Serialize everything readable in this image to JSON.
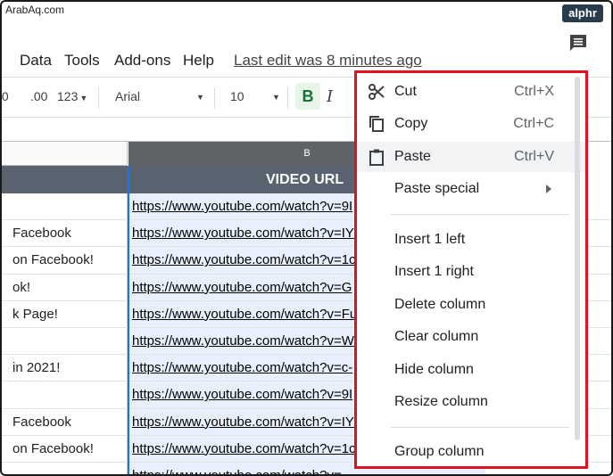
{
  "watermark": "ArabAq.com",
  "brand": "alphr",
  "menubar": {
    "data": "Data",
    "tools": "Tools",
    "addons": "Add-ons",
    "help": "Help",
    "last_edit": "Last edit was 8 minutes ago"
  },
  "toolbar": {
    "decimal_left": ".0",
    "decimal_right": ".00",
    "format_123": "123",
    "font": "Arial",
    "size": "10",
    "bold": "B",
    "italic": "I"
  },
  "sheet": {
    "col_b_letter": "B",
    "col_b_header": "VIDEO URL",
    "rows": [
      {
        "a": "",
        "b": "https://www.youtube.com/watch?v=9I"
      },
      {
        "a": "Facebook",
        "b": "https://www.youtube.com/watch?v=IY"
      },
      {
        "a": "on Facebook!",
        "b": "https://www.youtube.com/watch?v=1c"
      },
      {
        "a": "ok!",
        "b": "https://www.youtube.com/watch?v=G"
      },
      {
        "a": "k Page!",
        "b": "https://www.youtube.com/watch?v=Fu"
      },
      {
        "a": "",
        "b": "https://www.youtube.com/watch?v=W"
      },
      {
        "a": "in 2021!",
        "b": "https://www.youtube.com/watch?v=c-"
      },
      {
        "a": "",
        "b": "https://www.youtube.com/watch?v=9I"
      },
      {
        "a": "Facebook",
        "b": "https://www.youtube.com/watch?v=IY"
      },
      {
        "a": "on Facebook!",
        "b": "https://www.youtube.com/watch?v=1c"
      },
      {
        "a": "",
        "b": "https://www.youtube.com/watch?v="
      }
    ]
  },
  "context_menu": {
    "cut": {
      "label": "Cut",
      "shortcut": "Ctrl+X"
    },
    "copy": {
      "label": "Copy",
      "shortcut": "Ctrl+C"
    },
    "paste": {
      "label": "Paste",
      "shortcut": "Ctrl+V"
    },
    "paste_special": "Paste special",
    "insert_left": "Insert 1 left",
    "insert_right": "Insert 1 right",
    "delete_column": "Delete column",
    "clear_column": "Clear column",
    "hide_column": "Hide column",
    "resize_column": "Resize column",
    "group_column": "Group column"
  },
  "colors": {
    "highlight_border": "#e0121f",
    "header_bg": "#5a6470",
    "selection_bg": "#e8f0fe",
    "bold_active": "#137333"
  }
}
